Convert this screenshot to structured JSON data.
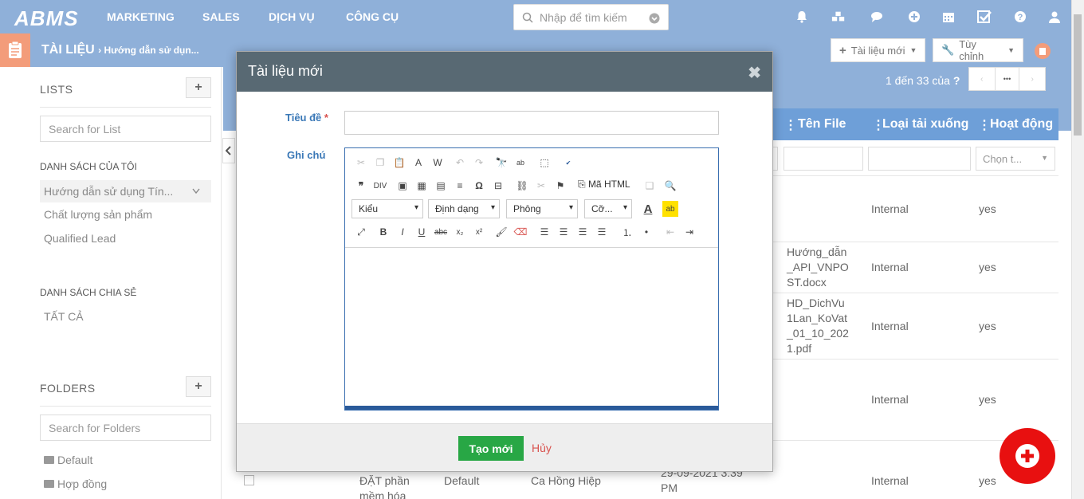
{
  "nav": {
    "logo": "ABMS",
    "items": [
      "MARKETING",
      "SALES",
      "DỊCH VỤ",
      "CÔNG CỤ"
    ],
    "search_placeholder": "Nhập để tìm kiếm"
  },
  "subbar": {
    "crumb_main": "TÀI LIỆU",
    "crumb_sub": "Hướng dẫn sử dụn...",
    "new_doc": "Tài liệu mới",
    "customize": "Tùy chỉnh",
    "pagination": "1 đến 33",
    "of": "của",
    "unknown": "?",
    "more": "•••"
  },
  "sidebar": {
    "lists_title": "LISTS",
    "list_search": "Search for List",
    "my_lists_title": "DANH SÁCH CỦA TÔI",
    "my_lists": [
      "Hướng dẫn sử dụng Tín...",
      "Chất lượng sản phẩm",
      "Qualified Lead"
    ],
    "shared_title": "DANH SÁCH CHIA SẺ",
    "shared": [
      "TẤT CẢ"
    ],
    "folders_title": "FOLDERS",
    "folder_search": "Search for Folders",
    "folders": [
      "Default",
      "Hợp đồng"
    ]
  },
  "table": {
    "headers": [
      "Tên File",
      "Loại tải xuống",
      "Hoạt động"
    ],
    "filter_placeholder": "Chọn t...",
    "rows": [
      {
        "file": "",
        "type": "Internal",
        "active": "yes"
      },
      {
        "file": "Hướng_dẫn_API_VNPOST.docx",
        "type": "Internal",
        "active": "yes"
      },
      {
        "file": "HD_DichVu1Lan_KoVat_01_10_2021.pdf",
        "type": "Internal",
        "active": "yes"
      },
      {
        "file": "",
        "type": "Internal",
        "active": "yes"
      },
      {
        "file": "",
        "type": "Internal",
        "active": "yes"
      }
    ],
    "last_row": {
      "title": "ĐẶT phần mềm hóa",
      "folder": "Default",
      "owner": "Ca Hồng Hiệp",
      "date": "29-09-2021 3:39 PM"
    }
  },
  "modal": {
    "title": "Tài liệu mới",
    "close": "✖",
    "title_label": "Tiêu đề",
    "required_mark": "*",
    "title_value": "",
    "note_label": "Ghi chú",
    "editor": {
      "html_source": "Mã HTML",
      "style": "Kiểu",
      "format": "Định dạng",
      "font": "Phông",
      "size": "Cỡ...",
      "bold": "B",
      "italic": "I",
      "underline": "U",
      "strike": "abc"
    },
    "create": "Tạo mới",
    "cancel": "Hủy"
  }
}
